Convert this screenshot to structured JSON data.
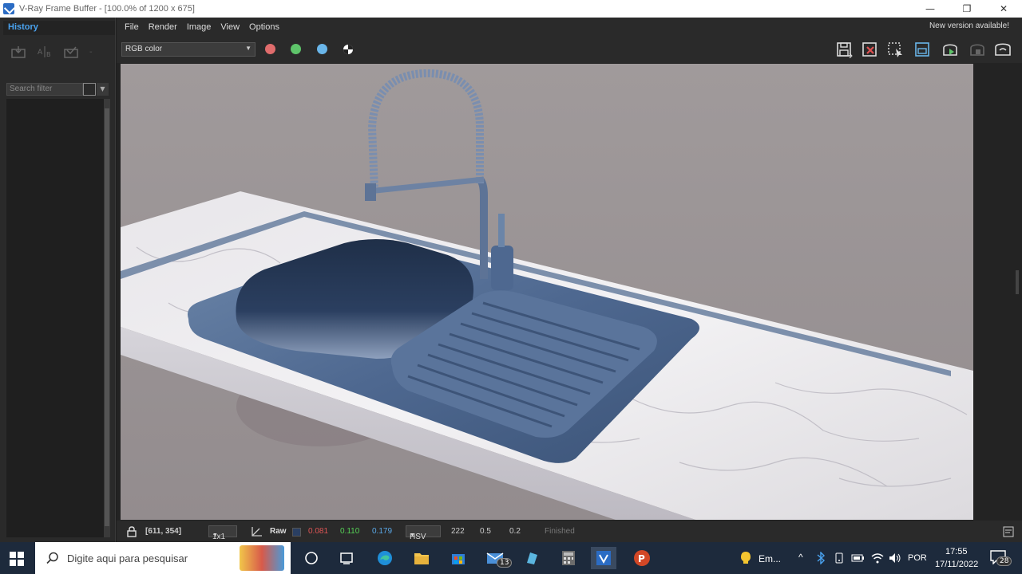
{
  "window": {
    "title": "V-Ray Frame Buffer - [100.0% of 1200 x 675]",
    "minimize": "—",
    "maximize": "❐",
    "close": "✕"
  },
  "history": {
    "tab_label": "History",
    "search_placeholder": "Search filter"
  },
  "menu": {
    "items": [
      "File",
      "Render",
      "Image",
      "View",
      "Options"
    ],
    "new_version": "New version available!"
  },
  "toolbar": {
    "channel": "RGB color",
    "colors": {
      "red": "#e06c6c",
      "green": "#5ec46a",
      "blue": "#6ab6ea"
    }
  },
  "status": {
    "coords": "[611, 354]",
    "sample": "1x1",
    "raw_label": "Raw",
    "r": "0.081",
    "g": "0.110",
    "b": "0.179",
    "r_color": "#e05555",
    "g_color": "#55d055",
    "b_color": "#5aa8e8",
    "mode": "HSV",
    "h": "222",
    "s": "0.5",
    "v": "0.2",
    "state": "Finished"
  },
  "taskbar": {
    "search_placeholder": "Digite aqui para pesquisar",
    "mail_badge": "13",
    "ppt_label": "Em...",
    "language": "POR",
    "time": "17:55",
    "date": "17/11/2022",
    "notif_badge": "28"
  }
}
